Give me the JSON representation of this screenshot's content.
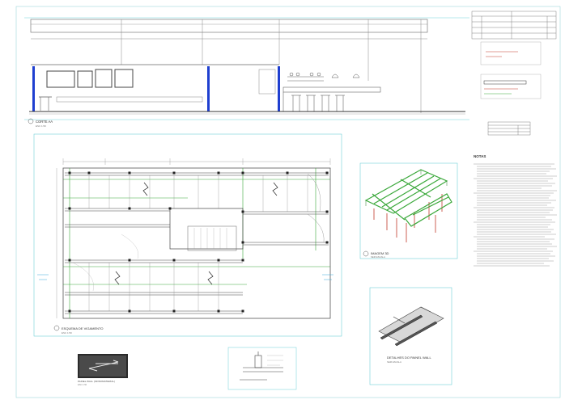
{
  "sheet": {
    "section_title": "CORTE AA",
    "section_scale": "ESC 1:50",
    "plan_title": "ESQUEMA DE VIGAMENTO",
    "plan_scale": "ESC 1:50",
    "view3d_title": "IMAGEM 3D",
    "view3d_scale": "SEM ESCALA",
    "notes_title": "NOTAS",
    "detail_title": "DETALHES DO PAINEL WALL",
    "detail_scale": "SEM ESCALA",
    "panel_label": "PAINEL WALL (MONOMATERIAL)",
    "panel_scale": "ESC 1:50"
  },
  "colors": {
    "line": "#555555",
    "frame": "#6fd0d8",
    "column": "#1f3fd0",
    "beam": "#3aa83a",
    "post3d": "#c0392b"
  }
}
